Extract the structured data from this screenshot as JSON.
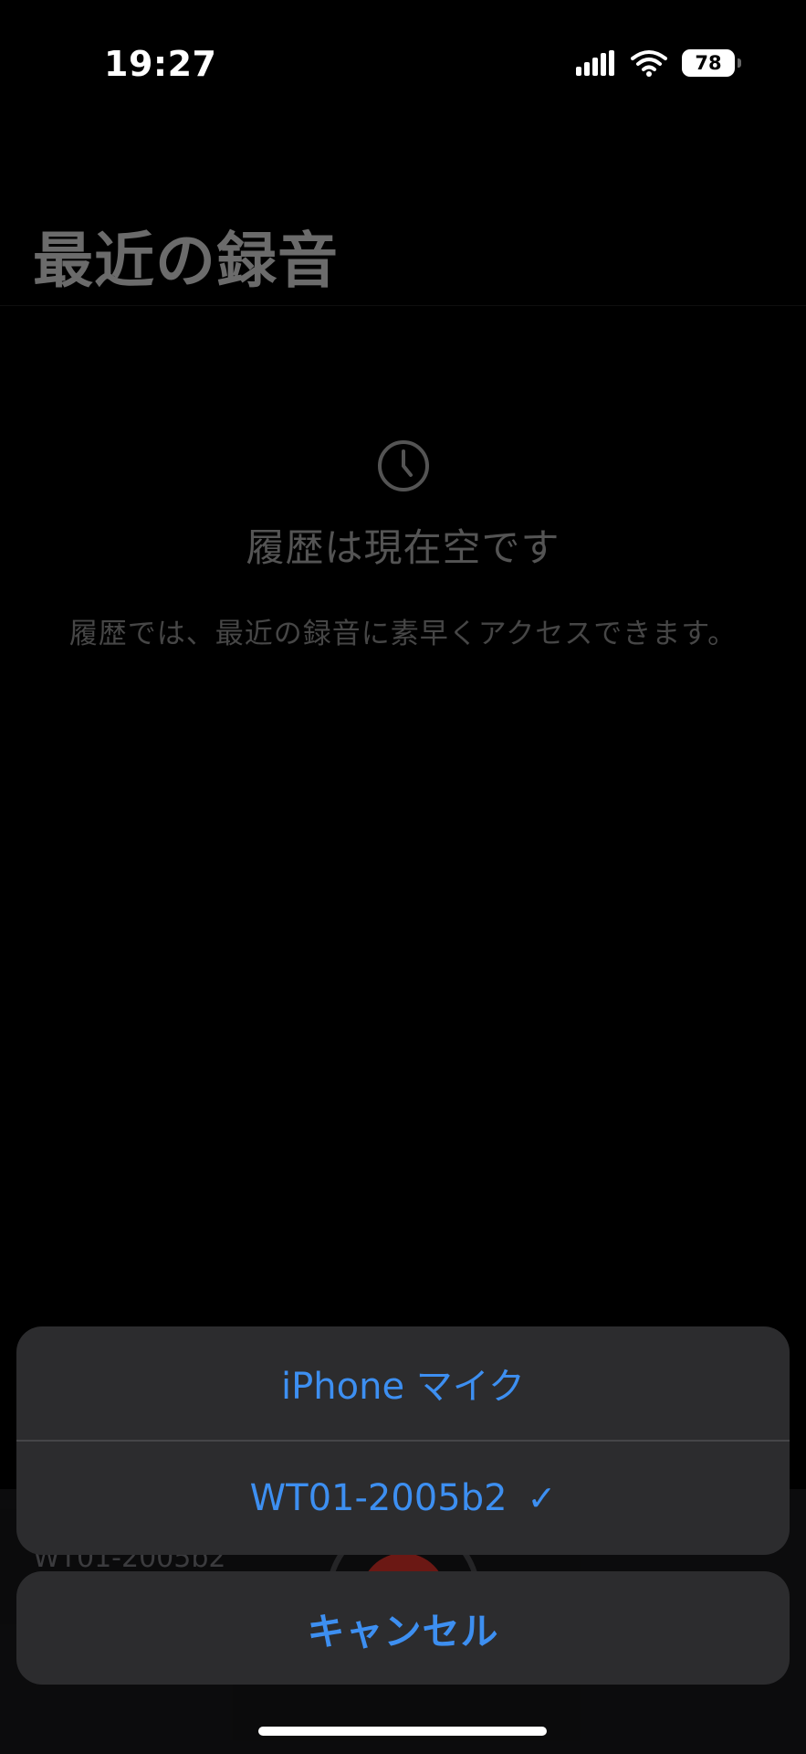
{
  "status_bar": {
    "time": "19:27",
    "battery_level": "78",
    "signal_icon": "cellular-signal-icon",
    "wifi_icon": "wifi-icon"
  },
  "page": {
    "title": "最近の録音"
  },
  "empty_state": {
    "icon": "clock-icon",
    "title": "履歴は現在空です",
    "description": "履歴では、最近の録音に素早くアクセスできます。"
  },
  "bottom_bar": {
    "device_label": "WT01-2005b2"
  },
  "action_sheet": {
    "options": [
      {
        "label": "iPhone マイク",
        "selected": false
      },
      {
        "label": "WT01-2005b2",
        "selected": true,
        "check": "✓"
      }
    ],
    "cancel_label": "キャンセル"
  },
  "colors": {
    "accent": "#3d8ff1",
    "sheet_background": "#2c2c2e",
    "record_red": "#ff3b30"
  }
}
